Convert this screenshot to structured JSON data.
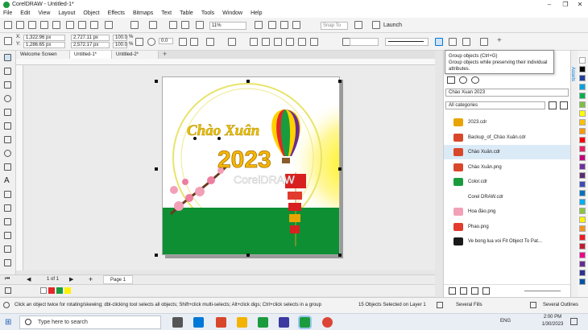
{
  "window": {
    "title": "CorelDRAW - Untitled-1*"
  },
  "menu": [
    "File",
    "Edit",
    "View",
    "Layout",
    "Object",
    "Effects",
    "Bitmaps",
    "Text",
    "Table",
    "Tools",
    "Window",
    "Help"
  ],
  "toolbar": {
    "zoom": "11%",
    "snap": "Snap To",
    "launch": "Launch"
  },
  "props": {
    "x": "1,322.96 px",
    "y": "1,286.65 px",
    "w": "2,727.11 px",
    "h": "2,572.17 px",
    "sx": "100.0",
    "sy": "100.0",
    "pct": "%",
    "angle": "0.0"
  },
  "tabs": [
    "Welcome Screen",
    "Untitled-1*",
    "Untitled-2*"
  ],
  "artwork": {
    "title_line": "Chào Xuân",
    "year": "2023",
    "brand": "CorelDRAW"
  },
  "pagenav": {
    "page_of": "1 of 1",
    "page_tab": "Page 1"
  },
  "tooltip": {
    "title": "Group objects (Ctrl+G)",
    "body": "Group objects while preserving their individual attributes."
  },
  "assets": {
    "docker_label": "Assets",
    "collection": "Chào Xuan 2023",
    "category": "All categories",
    "files": [
      {
        "name": "2023.cdr",
        "color": "#e8a400"
      },
      {
        "name": "Backup_of_Chào Xuân.cdr",
        "color": "#d9472b"
      },
      {
        "name": "Chào Xuân.cdr",
        "color": "#d9472b"
      },
      {
        "name": "Chào Xuân.png",
        "color": "#d9472b"
      },
      {
        "name": "Color.cdr",
        "color": "#1a9c3e"
      },
      {
        "name": "Corel DRAW.cdr",
        "color": "#ffffff"
      },
      {
        "name": "Hoa đào.png",
        "color": "#f2a0b8"
      },
      {
        "name": "Phao.png",
        "color": "#e23b2e"
      },
      {
        "name": "Ve bong lua voi Fit Object To Pat...",
        "color": "#1a1a1a"
      }
    ],
    "active_index": 2
  },
  "status": {
    "hint": "Click an object twice for rotating/skewing; dbl-clicking tool selects all objects; Shift+click multi-selects; Alt+click digs; Ctrl+click selects in a group",
    "selection": "15 Objects Selected on Layer 1",
    "fill": "Several Fills",
    "outline": "Several Outlines"
  },
  "taskbar": {
    "search": "Type here to search",
    "lang": "ENG",
    "time": "2:00 PM",
    "date": "1/30/2023"
  },
  "colors": {
    "accent": "#1a9c3e",
    "ground": "#0e8f34",
    "selection": "#0078d7"
  }
}
